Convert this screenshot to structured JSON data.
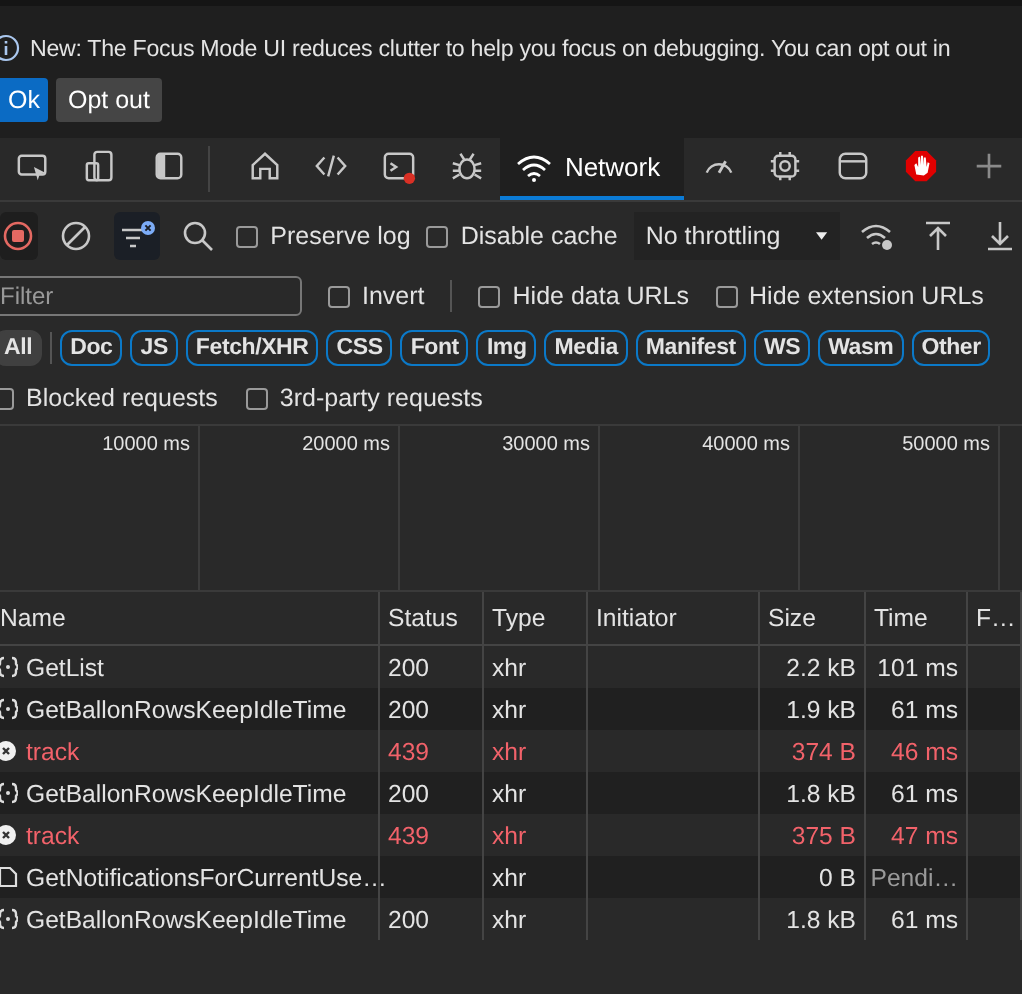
{
  "banner": {
    "message": "New: The Focus Mode UI reduces clutter to help you focus on debugging. You can opt out in",
    "buttons": [
      {
        "label": "Ok",
        "kind": "primary"
      },
      {
        "label": "Opt out",
        "kind": "secondary"
      }
    ]
  },
  "tabs": [
    {
      "kind": "icon",
      "selected": false
    },
    {
      "kind": "icon",
      "selected": false
    },
    {
      "kind": "icon",
      "selected": false
    },
    {
      "kind": "icon",
      "selected": false
    },
    {
      "kind": "icon",
      "selected": false
    },
    {
      "kind": "icon",
      "selected": false
    },
    {
      "kind": "icon",
      "selected": false
    },
    {
      "kind": "label",
      "label": "Network",
      "selected": true
    },
    {
      "kind": "icon",
      "selected": false
    },
    {
      "kind": "icon",
      "selected": false
    },
    {
      "kind": "icon",
      "selected": false
    },
    {
      "kind": "icon",
      "selected": false
    },
    {
      "kind": "icon",
      "selected": false
    }
  ],
  "toolbar": {
    "recording": true,
    "options": [
      {
        "label": "Preserve log",
        "checked": false
      },
      {
        "label": "Disable cache",
        "checked": false
      }
    ],
    "throttling": "No throttling"
  },
  "filter": {
    "placeholder": "Filter",
    "options": [
      {
        "label": "Invert",
        "checked": false
      },
      {
        "label": "Hide data URLs",
        "checked": false
      },
      {
        "label": "Hide extension URLs",
        "checked": false
      }
    ]
  },
  "type_filters": [
    {
      "label": "All",
      "selected": true
    },
    {
      "label": "Doc",
      "selected": false
    },
    {
      "label": "JS",
      "selected": false
    },
    {
      "label": "Fetch/XHR",
      "selected": false
    },
    {
      "label": "CSS",
      "selected": false
    },
    {
      "label": "Font",
      "selected": false
    },
    {
      "label": "Img",
      "selected": false
    },
    {
      "label": "Media",
      "selected": false
    },
    {
      "label": "Manifest",
      "selected": false
    },
    {
      "label": "WS",
      "selected": false
    },
    {
      "label": "Wasm",
      "selected": false
    },
    {
      "label": "Other",
      "selected": false
    }
  ],
  "request_options": [
    {
      "label": "Blocked requests",
      "checked": false
    },
    {
      "label": "3rd-party requests",
      "checked": false
    }
  ],
  "overview": {
    "ticks": [
      "10000 ms",
      "20000 ms",
      "30000 ms",
      "40000 ms",
      "50000 ms"
    ]
  },
  "table": {
    "columns": [
      "Name",
      "Status",
      "Type",
      "Initiator",
      "Size",
      "Time",
      "F…"
    ],
    "rows": [
      {
        "kind": "ok",
        "name": "GetList",
        "status": "200",
        "type": "xhr",
        "size": "2.2 kB",
        "time": "101 ms"
      },
      {
        "kind": "ok",
        "name": "GetBallonRowsKeepIdleTime",
        "status": "200",
        "type": "xhr",
        "size": "1.9 kB",
        "time": "61 ms"
      },
      {
        "kind": "failed",
        "name": "track",
        "status": "439",
        "type": "xhr",
        "size": "374 B",
        "time": "46 ms"
      },
      {
        "kind": "ok",
        "name": "GetBallonRowsKeepIdleTime",
        "status": "200",
        "type": "xhr",
        "size": "1.8 kB",
        "time": "61 ms"
      },
      {
        "kind": "failed",
        "name": "track",
        "status": "439",
        "type": "xhr",
        "size": "375 B",
        "time": "47 ms"
      },
      {
        "kind": "pending",
        "name": "GetNotificationsForCurrentUse…",
        "type": "xhr",
        "size": "0 B",
        "time": "Pendi…"
      },
      {
        "kind": "ok",
        "name": "GetBallonRowsKeepIdleTime",
        "status": "200",
        "type": "xhr",
        "size": "1.8 kB",
        "time": "61 ms"
      }
    ]
  }
}
